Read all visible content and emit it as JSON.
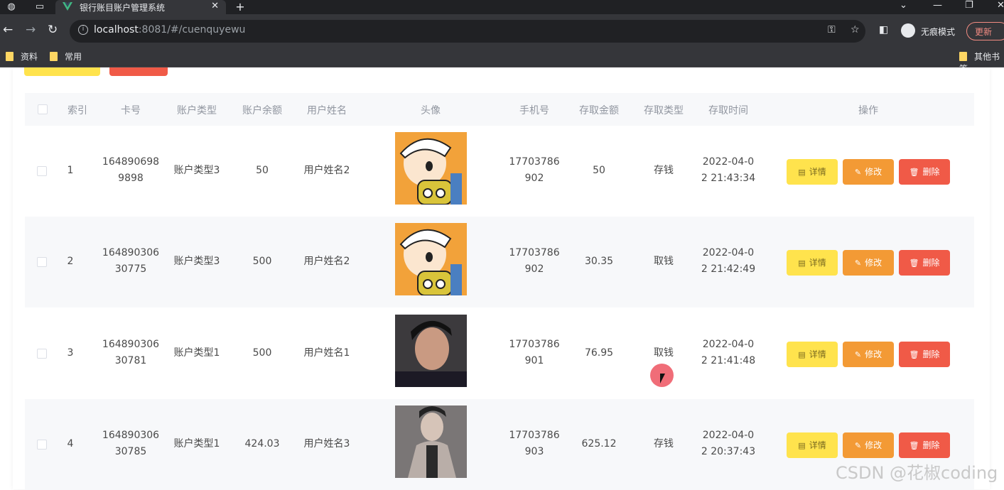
{
  "browser": {
    "tab_title": "银行账目账户管理系统",
    "url_host": "localhost",
    "url_rest": ":8081/#/cuenquyewu",
    "incognito_label": "无痕模式",
    "update_label": "更新",
    "bookmarks": [
      "资料",
      "常用"
    ],
    "other_bookmarks": "其他书签"
  },
  "table": {
    "headers": [
      "索引",
      "卡号",
      "账户类型",
      "账户余额",
      "用户姓名",
      "头像",
      "手机号",
      "存取金额",
      "存取类型",
      "存取时间",
      "操作"
    ],
    "rows": [
      {
        "index": "1",
        "card1": "164890698",
        "card2": "9898",
        "type": "账户类型3",
        "balance": "50",
        "name": "用户姓名2",
        "avatar": "cartoon",
        "phone1": "17703786",
        "phone2": "902",
        "amount": "50",
        "op_type": "存钱",
        "time1": "2022-04-0",
        "time2": "2 21:43:34"
      },
      {
        "index": "2",
        "card1": "164890306",
        "card2": "30775",
        "type": "账户类型3",
        "balance": "500",
        "name": "用户姓名2",
        "avatar": "cartoon",
        "phone1": "17703786",
        "phone2": "902",
        "amount": "30.35",
        "op_type": "取钱",
        "time1": "2022-04-0",
        "time2": "2 21:42:49"
      },
      {
        "index": "3",
        "card1": "164890306",
        "card2": "30781",
        "type": "账户类型1",
        "balance": "500",
        "name": "用户姓名1",
        "avatar": "photo-dark",
        "phone1": "17703786",
        "phone2": "901",
        "amount": "76.95",
        "op_type": "取钱",
        "time1": "2022-04-0",
        "time2": "2 21:41:48"
      },
      {
        "index": "4",
        "card1": "164890306",
        "card2": "30785",
        "type": "账户类型1",
        "balance": "424.03",
        "name": "用户姓名3",
        "avatar": "photo-grey",
        "phone1": "17703786",
        "phone2": "903",
        "amount": "625.12",
        "op_type": "存钱",
        "time1": "2022-04-0",
        "time2": "2 20:37:43"
      }
    ],
    "actions": {
      "detail": "详情",
      "edit": "修改",
      "delete": "删除"
    }
  },
  "watermark": "CSDN @花椒coding",
  "colors": {
    "detail": "#ffe34d",
    "edit": "#f39a35",
    "delete": "#f05a47"
  }
}
